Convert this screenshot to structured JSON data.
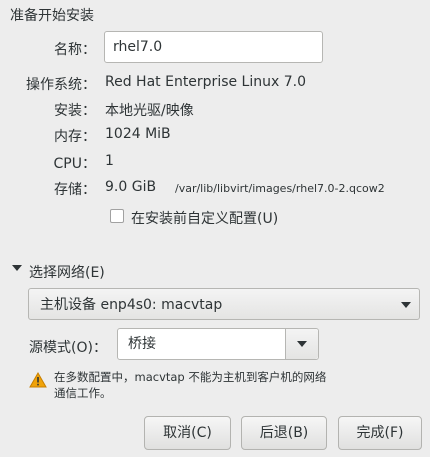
{
  "header": {
    "title": "准备开始安装"
  },
  "name": {
    "label": "名称：",
    "value": "rhel7.0"
  },
  "details": [
    {
      "label": "操作系统：",
      "value": "Red Hat Enterprise Linux 7.0"
    },
    {
      "label": "安装：",
      "value": "本地光驱/映像"
    },
    {
      "label": "内存：",
      "value": "1024 MiB"
    },
    {
      "label": "CPU：",
      "value": "1"
    }
  ],
  "storage": {
    "label": "存储：",
    "size": "9.0 GiB",
    "path": "/var/lib/libvirt/images/rhel7.0-2.qcow2"
  },
  "customize": {
    "label": "在安装前自定义配置(U)",
    "checked": false
  },
  "network": {
    "expander_label": "选择网络(E)",
    "device": "主机设备  enp4s0: macvtap",
    "source_mode_label": "源模式(O)：",
    "source_mode_value": "桥接",
    "warning_line1": "在多数配置中，macvtap 不能为主机到客户机的网络",
    "warning_line2": "通信工作。"
  },
  "buttons": {
    "cancel": "取消(C)",
    "back": "后退(B)",
    "finish": "完成(F)"
  },
  "colors": {
    "background": "#ededed",
    "warning": "#f0a30a"
  }
}
